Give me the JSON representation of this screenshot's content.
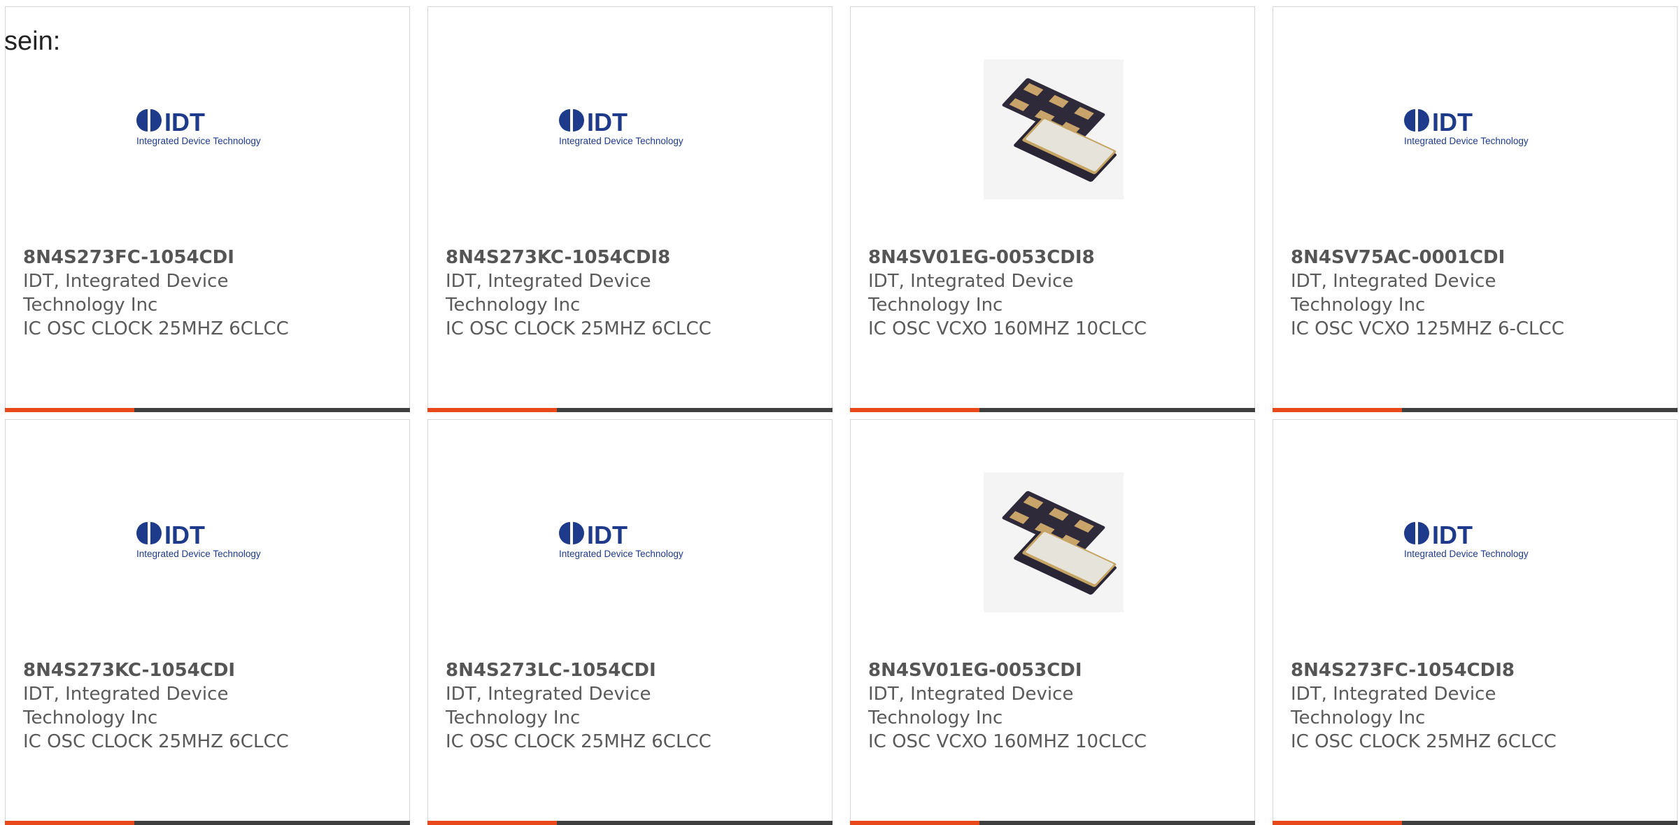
{
  "intro_text": "sein:",
  "colors": {
    "accent": "#e8481a",
    "bar": "#3f3f3f",
    "logo_blue": "#1e3a8a"
  },
  "products": [
    {
      "part_number": "8N4S273FC-1054CDI",
      "manufacturer": "IDT, Integrated Device Technology Inc",
      "description": "IC OSC CLOCK 25MHZ 6CLCC",
      "image": "idt-logo",
      "logo_mark": "IDT",
      "logo_sub": "Integrated Device Technology"
    },
    {
      "part_number": "8N4S273KC-1054CDI8",
      "manufacturer": "IDT, Integrated Device Technology Inc",
      "description": "IC OSC CLOCK 25MHZ 6CLCC",
      "image": "idt-logo",
      "logo_mark": "IDT",
      "logo_sub": "Integrated Device Technology"
    },
    {
      "part_number": "8N4SV01EG-0053CDI8",
      "manufacturer": "IDT, Integrated Device Technology Inc",
      "description": "IC OSC VCXO 160MHZ 10CLCC",
      "image": "oscillator-chip-photo",
      "logo_mark": "",
      "logo_sub": ""
    },
    {
      "part_number": "8N4SV75AC-0001CDI",
      "manufacturer": "IDT, Integrated Device Technology Inc",
      "description": "IC OSC VCXO 125MHZ 6-CLCC",
      "image": "idt-logo",
      "logo_mark": "IDT",
      "logo_sub": "Integrated Device Technology"
    },
    {
      "part_number": "8N4S273KC-1054CDI",
      "manufacturer": "IDT, Integrated Device Technology Inc",
      "description": "IC OSC CLOCK 25MHZ 6CLCC",
      "image": "idt-logo",
      "logo_mark": "IDT",
      "logo_sub": "Integrated Device Technology"
    },
    {
      "part_number": "8N4S273LC-1054CDI",
      "manufacturer": "IDT, Integrated Device Technology Inc",
      "description": "IC OSC CLOCK 25MHZ 6CLCC",
      "image": "idt-logo",
      "logo_mark": "IDT",
      "logo_sub": "Integrated Device Technology"
    },
    {
      "part_number": "8N4SV01EG-0053CDI",
      "manufacturer": "IDT, Integrated Device Technology Inc",
      "description": "IC OSC VCXO 160MHZ 10CLCC",
      "image": "oscillator-chip-photo",
      "logo_mark": "",
      "logo_sub": ""
    },
    {
      "part_number": "8N4S273FC-1054CDI8",
      "manufacturer": "IDT, Integrated Device Technology Inc",
      "description": "IC OSC CLOCK 25MHZ 6CLCC",
      "image": "idt-logo",
      "logo_mark": "IDT",
      "logo_sub": "Integrated Device Technology"
    }
  ]
}
